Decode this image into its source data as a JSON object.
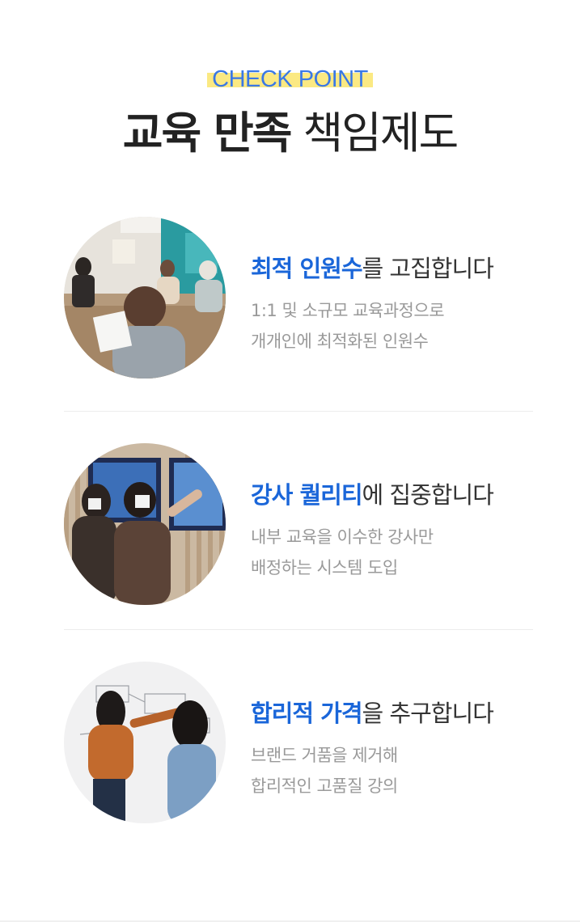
{
  "header": {
    "eyebrow": "CHECK POINT",
    "title_bold": "교육 만족",
    "title_light": "책임제도"
  },
  "points": [
    {
      "head_em": "최적 인원수",
      "head_rest": "를 고집합니다",
      "desc_line1": "1:1 및 소규모 교육과정으로",
      "desc_line2": "개개인에 최적화된 인원수",
      "photo_icon": "classroom-photo"
    },
    {
      "head_em": "강사 퀄리티",
      "head_rest": "에 집중합니다",
      "desc_line1": "내부 교육을 이수한 강사만",
      "desc_line2": "배정하는 시스템 도입",
      "photo_icon": "instructor-photo"
    },
    {
      "head_em": "합리적 가격",
      "head_rest": "을 추구합니다",
      "desc_line1": "브랜드 거품을 제거해",
      "desc_line2": "합리적인 고품질 강의",
      "photo_icon": "whiteboard-photo"
    }
  ],
  "colors": {
    "accent": "#1a66d9",
    "eyebrow": "#3a78e6",
    "highlight": "#fbe983"
  }
}
